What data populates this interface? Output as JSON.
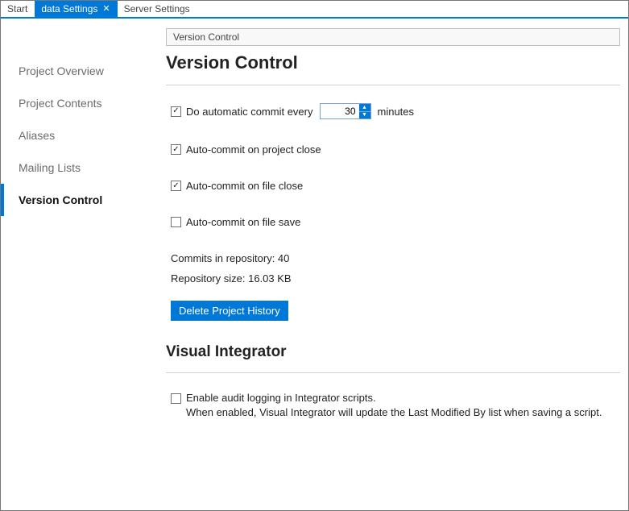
{
  "tabs": {
    "start": "Start",
    "data_settings": "data Settings",
    "server_settings": "Server Settings"
  },
  "sidebar": {
    "items": [
      {
        "label": "Project Overview"
      },
      {
        "label": "Project Contents"
      },
      {
        "label": "Aliases"
      },
      {
        "label": "Mailing Lists"
      },
      {
        "label": "Version Control"
      }
    ]
  },
  "breadcrumb": "Version Control",
  "vc": {
    "heading": "Version Control",
    "auto_commit_label_pre": "Do automatic commit every",
    "auto_commit_value": "30",
    "auto_commit_label_post": "minutes",
    "on_project_close": "Auto-commit on project close",
    "on_file_close": "Auto-commit on file close",
    "on_file_save": "Auto-commit on file save",
    "commits_line": "Commits in repository: 40",
    "size_line": "Repository size: 16.03 KB",
    "delete_btn": "Delete Project History"
  },
  "vi": {
    "heading": "Visual Integrator",
    "hint_line1": "Enable audit logging in Integrator scripts.",
    "hint_line2": "When enabled, Visual Integrator will update the Last Modified By list when saving a script."
  }
}
